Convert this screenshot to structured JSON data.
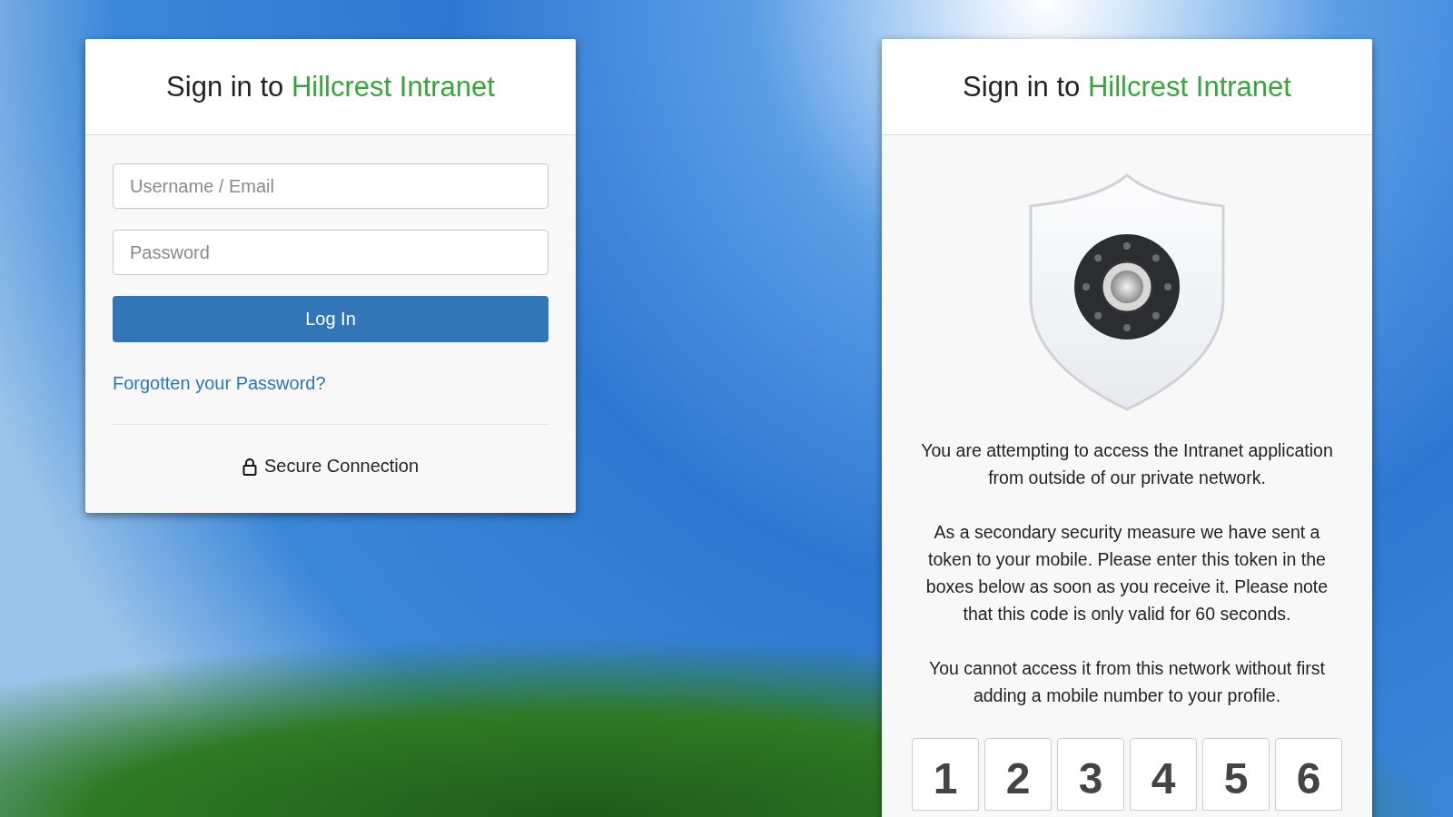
{
  "login_card": {
    "title": {
      "text": "Sign in to",
      "brand": "Hillcrest Intranet"
    },
    "username": {
      "placeholder": "Username / Email"
    },
    "password": {
      "placeholder": "Password"
    },
    "login_button": "Log In",
    "forgot_link": "Forgotten your Password?",
    "secure_note": "Secure Connection"
  },
  "token_card": {
    "title": {
      "text": "Sign in to",
      "brand": "Hillcrest Intranet"
    },
    "paragraphs": [
      "You are attempting to access the Intranet application from outside of our private network.",
      "As a secondary security measure we have sent a token to your mobile. Please enter this token in the boxes below as soon as you receive it. Please note that this code is only valid for 60 seconds.",
      "You cannot access it from this network without first adding a mobile number to your profile."
    ],
    "code_digits": [
      "1",
      "2",
      "3",
      "4",
      "5",
      "6"
    ]
  }
}
